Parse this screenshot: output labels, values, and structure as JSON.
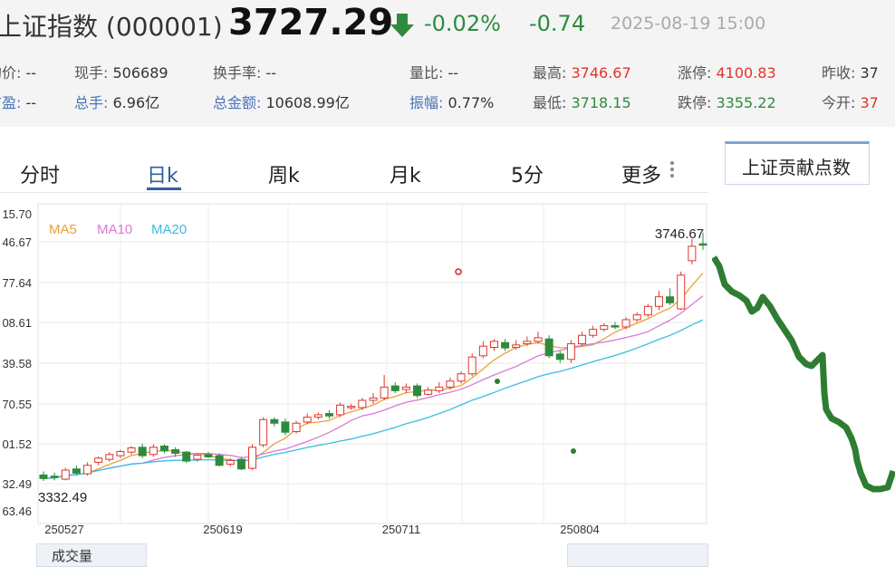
{
  "quote": {
    "name": "上证指数 (000001)",
    "price": "3727.29",
    "change_pct": "-0.02%",
    "change": "-0.74",
    "datetime": "2025-08-19 15:00",
    "down_color": "#2e8b3d",
    "up_color": "#e0352b"
  },
  "stats": {
    "avg_label": "均价:",
    "avg_value": "--",
    "cur_vol_label": "现手:",
    "cur_vol_value": "506689",
    "turnover_label": "换手率:",
    "turnover_value": "--",
    "vol_ratio_label": "量比:",
    "vol_ratio_value": "--",
    "high_label": "最高:",
    "high_value": "3746.67",
    "limit_up_label": "涨停:",
    "limit_up_value": "4100.83",
    "prev_close_label": "昨收:",
    "prev_close_value": "37",
    "pe_label": "市盈:",
    "pe_value": "--",
    "total_vol_label": "总手:",
    "total_vol_value": "6.96亿",
    "amount_label": "总金额:",
    "amount_value": "10608.99亿",
    "amplitude_label": "振幅:",
    "amplitude_value": "0.77%",
    "low_label": "最低:",
    "low_value": "3718.15",
    "limit_down_label": "跌停:",
    "limit_down_value": "3355.22",
    "open_label": "今开:",
    "open_value": "37"
  },
  "tabs": [
    "分时",
    "日k",
    "周k",
    "月k",
    "5分",
    "更多"
  ],
  "active_tab": "日k",
  "side_tab_label": "上证贡献点数",
  "volume_tab_label": "成交量",
  "chart_data": {
    "type": "candlestick",
    "legend": [
      "MA5",
      "MA10",
      "MA20"
    ],
    "legend_colors": [
      "#e8a23a",
      "#d97ad6",
      "#3bbde0"
    ],
    "y_ticks": [
      "15.70",
      "46.67",
      "77.64",
      "08.61",
      "39.58",
      "70.55",
      "01.52",
      "32.49",
      "63.46"
    ],
    "x_ticks": [
      "250527",
      "250619",
      "250711",
      "250804"
    ],
    "max_label": "3746.67",
    "min_label": "3332.49",
    "grid": true,
    "candles": [
      {
        "o": 3344,
        "h": 3350,
        "l": 3334,
        "c": 3338
      },
      {
        "o": 3342,
        "h": 3348,
        "l": 3335,
        "c": 3340
      },
      {
        "o": 3337,
        "h": 3356,
        "l": 3335,
        "c": 3352
      },
      {
        "o": 3354,
        "h": 3360,
        "l": 3344,
        "c": 3347
      },
      {
        "o": 3346,
        "h": 3365,
        "l": 3343,
        "c": 3360
      },
      {
        "o": 3365,
        "h": 3375,
        "l": 3360,
        "c": 3372
      },
      {
        "o": 3370,
        "h": 3382,
        "l": 3366,
        "c": 3378
      },
      {
        "o": 3376,
        "h": 3386,
        "l": 3372,
        "c": 3383
      },
      {
        "o": 3382,
        "h": 3392,
        "l": 3378,
        "c": 3389
      },
      {
        "o": 3390,
        "h": 3396,
        "l": 3372,
        "c": 3376
      },
      {
        "o": 3378,
        "h": 3395,
        "l": 3374,
        "c": 3390
      },
      {
        "o": 3392,
        "h": 3395,
        "l": 3380,
        "c": 3384
      },
      {
        "o": 3386,
        "h": 3390,
        "l": 3374,
        "c": 3380
      },
      {
        "o": 3382,
        "h": 3384,
        "l": 3364,
        "c": 3367
      },
      {
        "o": 3370,
        "h": 3380,
        "l": 3366,
        "c": 3377
      },
      {
        "o": 3378,
        "h": 3382,
        "l": 3372,
        "c": 3374
      },
      {
        "o": 3376,
        "h": 3380,
        "l": 3358,
        "c": 3360
      },
      {
        "o": 3362,
        "h": 3372,
        "l": 3358,
        "c": 3368
      },
      {
        "o": 3370,
        "h": 3374,
        "l": 3352,
        "c": 3354
      },
      {
        "o": 3355,
        "h": 3395,
        "l": 3352,
        "c": 3390
      },
      {
        "o": 3394,
        "h": 3440,
        "l": 3390,
        "c": 3436
      },
      {
        "o": 3436,
        "h": 3440,
        "l": 3425,
        "c": 3430
      },
      {
        "o": 3432,
        "h": 3438,
        "l": 3410,
        "c": 3415
      },
      {
        "o": 3416,
        "h": 3434,
        "l": 3413,
        "c": 3430
      },
      {
        "o": 3432,
        "h": 3446,
        "l": 3428,
        "c": 3440
      },
      {
        "o": 3440,
        "h": 3448,
        "l": 3436,
        "c": 3444
      },
      {
        "o": 3446,
        "h": 3452,
        "l": 3437,
        "c": 3442
      },
      {
        "o": 3444,
        "h": 3464,
        "l": 3440,
        "c": 3460
      },
      {
        "o": 3456,
        "h": 3462,
        "l": 3452,
        "c": 3458
      },
      {
        "o": 3456,
        "h": 3472,
        "l": 3452,
        "c": 3468
      },
      {
        "o": 3468,
        "h": 3480,
        "l": 3462,
        "c": 3472
      },
      {
        "o": 3472,
        "h": 3510,
        "l": 3468,
        "c": 3490
      },
      {
        "o": 3492,
        "h": 3498,
        "l": 3480,
        "c": 3484
      },
      {
        "o": 3486,
        "h": 3496,
        "l": 3480,
        "c": 3490
      },
      {
        "o": 3492,
        "h": 3496,
        "l": 3472,
        "c": 3476
      },
      {
        "o": 3478,
        "h": 3490,
        "l": 3476,
        "c": 3485
      },
      {
        "o": 3484,
        "h": 3498,
        "l": 3480,
        "c": 3490
      },
      {
        "o": 3490,
        "h": 3506,
        "l": 3486,
        "c": 3500
      },
      {
        "o": 3500,
        "h": 3516,
        "l": 3496,
        "c": 3512
      },
      {
        "o": 3512,
        "h": 3546,
        "l": 3508,
        "c": 3540
      },
      {
        "o": 3542,
        "h": 3566,
        "l": 3538,
        "c": 3558
      },
      {
        "o": 3556,
        "h": 3570,
        "l": 3550,
        "c": 3566
      },
      {
        "o": 3564,
        "h": 3570,
        "l": 3550,
        "c": 3555
      },
      {
        "o": 3556,
        "h": 3568,
        "l": 3552,
        "c": 3560
      },
      {
        "o": 3562,
        "h": 3574,
        "l": 3558,
        "c": 3566
      },
      {
        "o": 3566,
        "h": 3582,
        "l": 3562,
        "c": 3572
      },
      {
        "o": 3570,
        "h": 3576,
        "l": 3538,
        "c": 3542
      },
      {
        "o": 3545,
        "h": 3550,
        "l": 3530,
        "c": 3536
      },
      {
        "o": 3536,
        "h": 3568,
        "l": 3530,
        "c": 3562
      },
      {
        "o": 3562,
        "h": 3582,
        "l": 3558,
        "c": 3576
      },
      {
        "o": 3576,
        "h": 3592,
        "l": 3572,
        "c": 3586
      },
      {
        "o": 3586,
        "h": 3596,
        "l": 3582,
        "c": 3592
      },
      {
        "o": 3592,
        "h": 3598,
        "l": 3586,
        "c": 3590
      },
      {
        "o": 3590,
        "h": 3606,
        "l": 3586,
        "c": 3602
      },
      {
        "o": 3602,
        "h": 3614,
        "l": 3598,
        "c": 3610
      },
      {
        "o": 3610,
        "h": 3628,
        "l": 3606,
        "c": 3624
      },
      {
        "o": 3624,
        "h": 3650,
        "l": 3618,
        "c": 3640
      },
      {
        "o": 3640,
        "h": 3654,
        "l": 3626,
        "c": 3630
      },
      {
        "o": 3620,
        "h": 3682,
        "l": 3618,
        "c": 3676
      },
      {
        "o": 3700,
        "h": 3736,
        "l": 3694,
        "c": 3724
      },
      {
        "o": 3728,
        "h": 3746.67,
        "l": 3718,
        "c": 3727.29
      }
    ]
  }
}
